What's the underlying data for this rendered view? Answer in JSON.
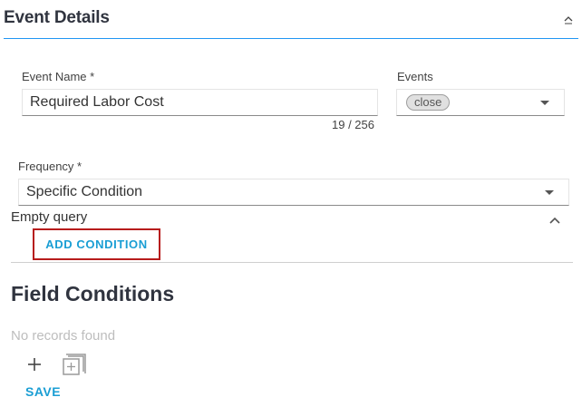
{
  "section": {
    "title": "Event Details"
  },
  "event_name": {
    "label": "Event Name *",
    "value": "Required Labor Cost",
    "counter": "19 / 256"
  },
  "events": {
    "label": "Events",
    "chip": "close"
  },
  "frequency": {
    "label": "Frequency *",
    "value": "Specific Condition"
  },
  "query": {
    "empty_text": "Empty query",
    "add_condition_label": "ADD CONDITION"
  },
  "field_conditions": {
    "title": "Field Conditions",
    "empty_text": "No records found",
    "add_icon": "plus-icon",
    "add_group_icon": "add-group-icon"
  },
  "actions": {
    "save_label": "SAVE"
  },
  "colors": {
    "accent_blue": "#1a9ed4",
    "header_underline": "#2196f3",
    "highlight_border": "#b71c1c"
  }
}
